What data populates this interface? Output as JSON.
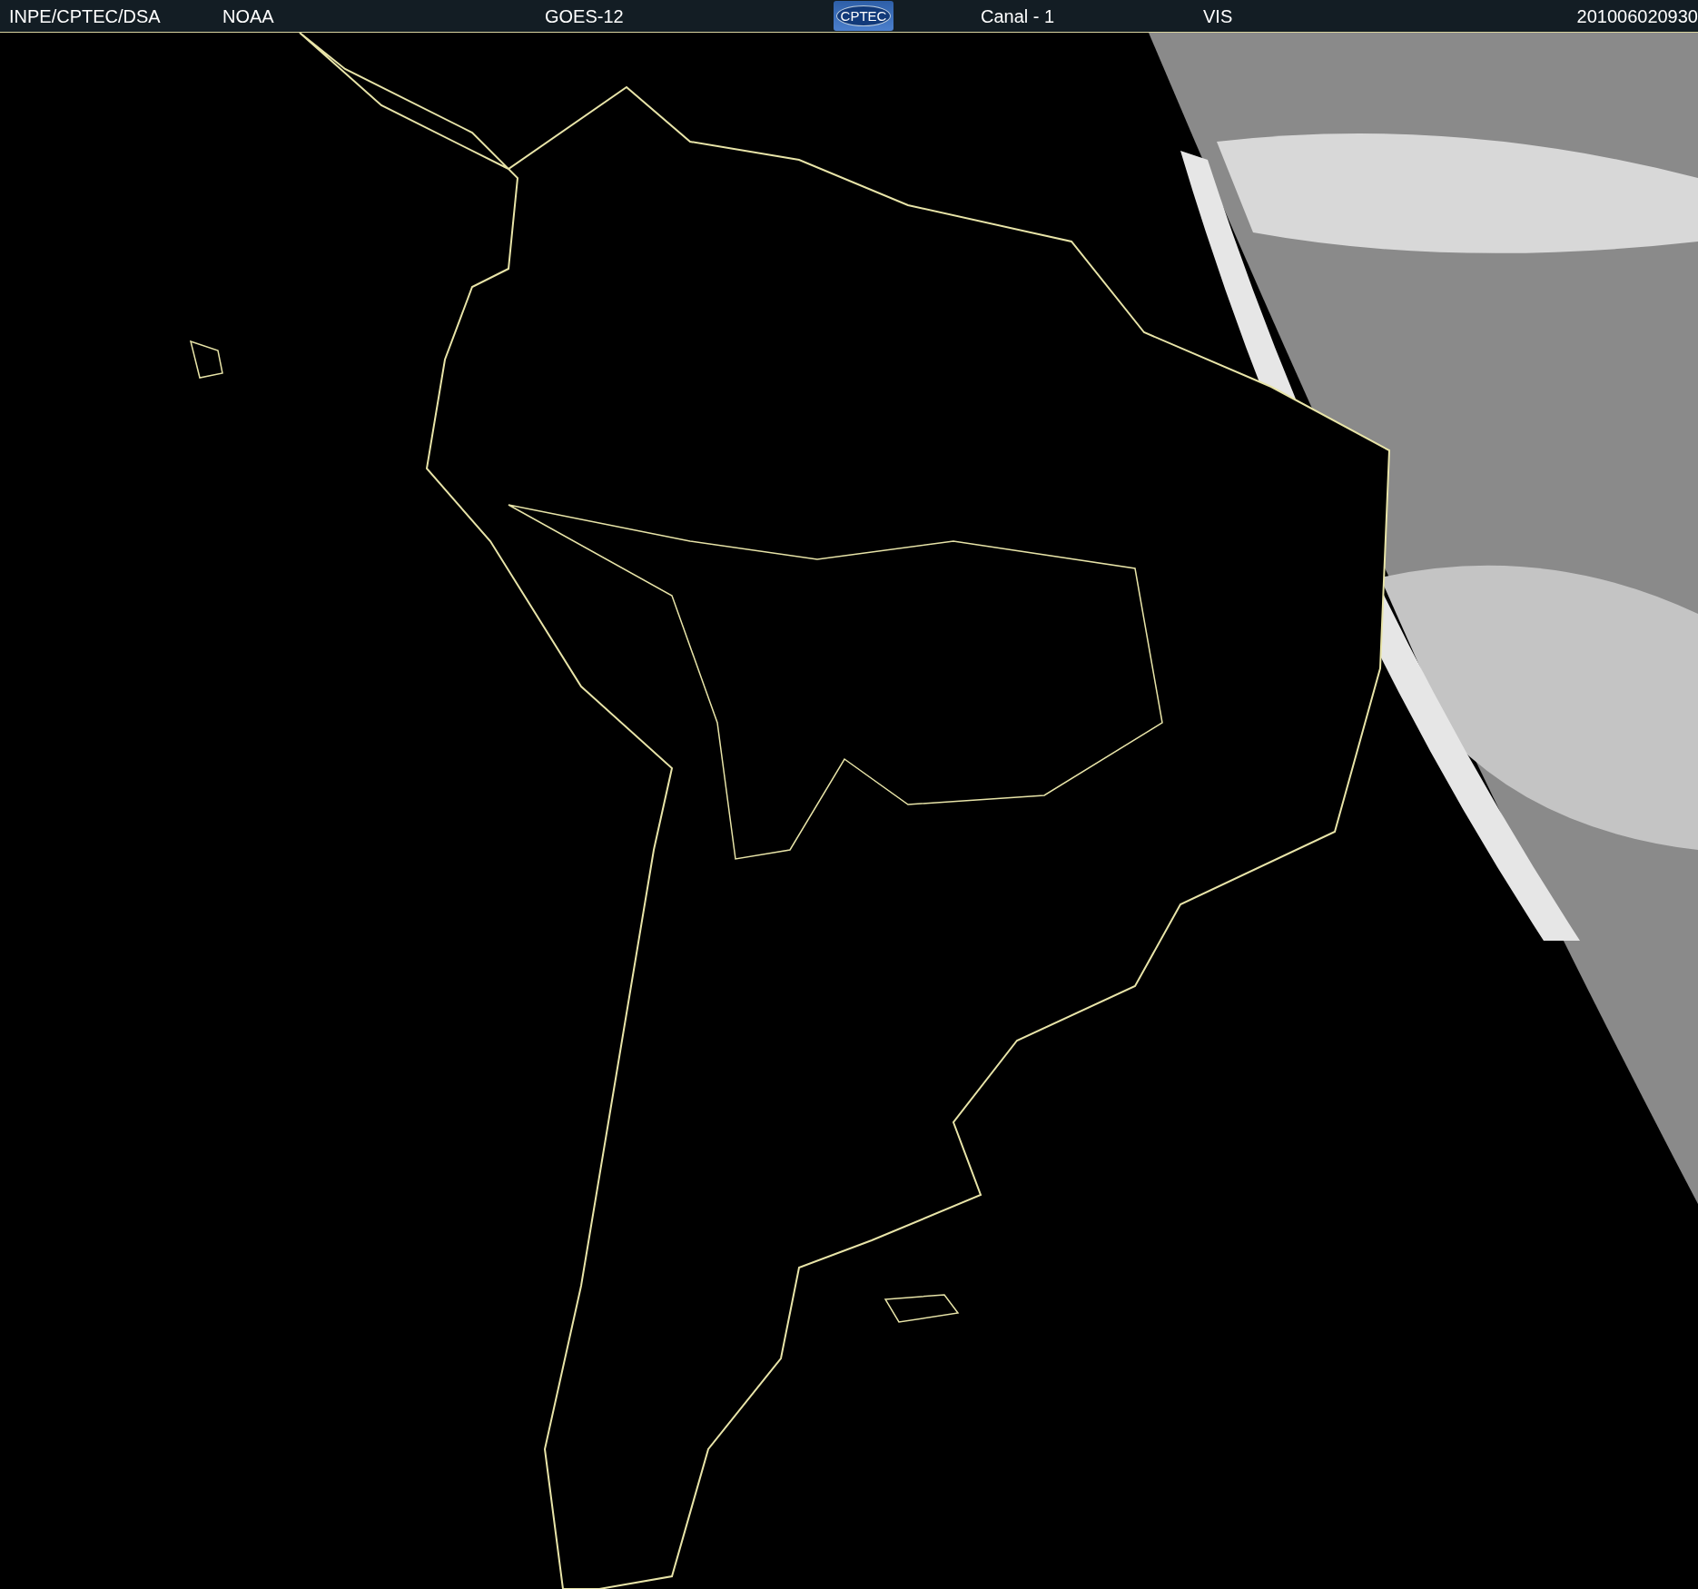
{
  "header": {
    "items": [
      {
        "kind": "text",
        "text": "INPE/CPTEC/DSA"
      },
      {
        "kind": "text",
        "text": "NOAA"
      },
      {
        "kind": "text",
        "text": "GOES-12"
      },
      {
        "kind": "logo",
        "text": "CPTEC"
      },
      {
        "kind": "text",
        "text": "Canal - 1"
      },
      {
        "kind": "text",
        "text": "VIS"
      },
      {
        "kind": "text",
        "text": "201006020930"
      }
    ]
  }
}
